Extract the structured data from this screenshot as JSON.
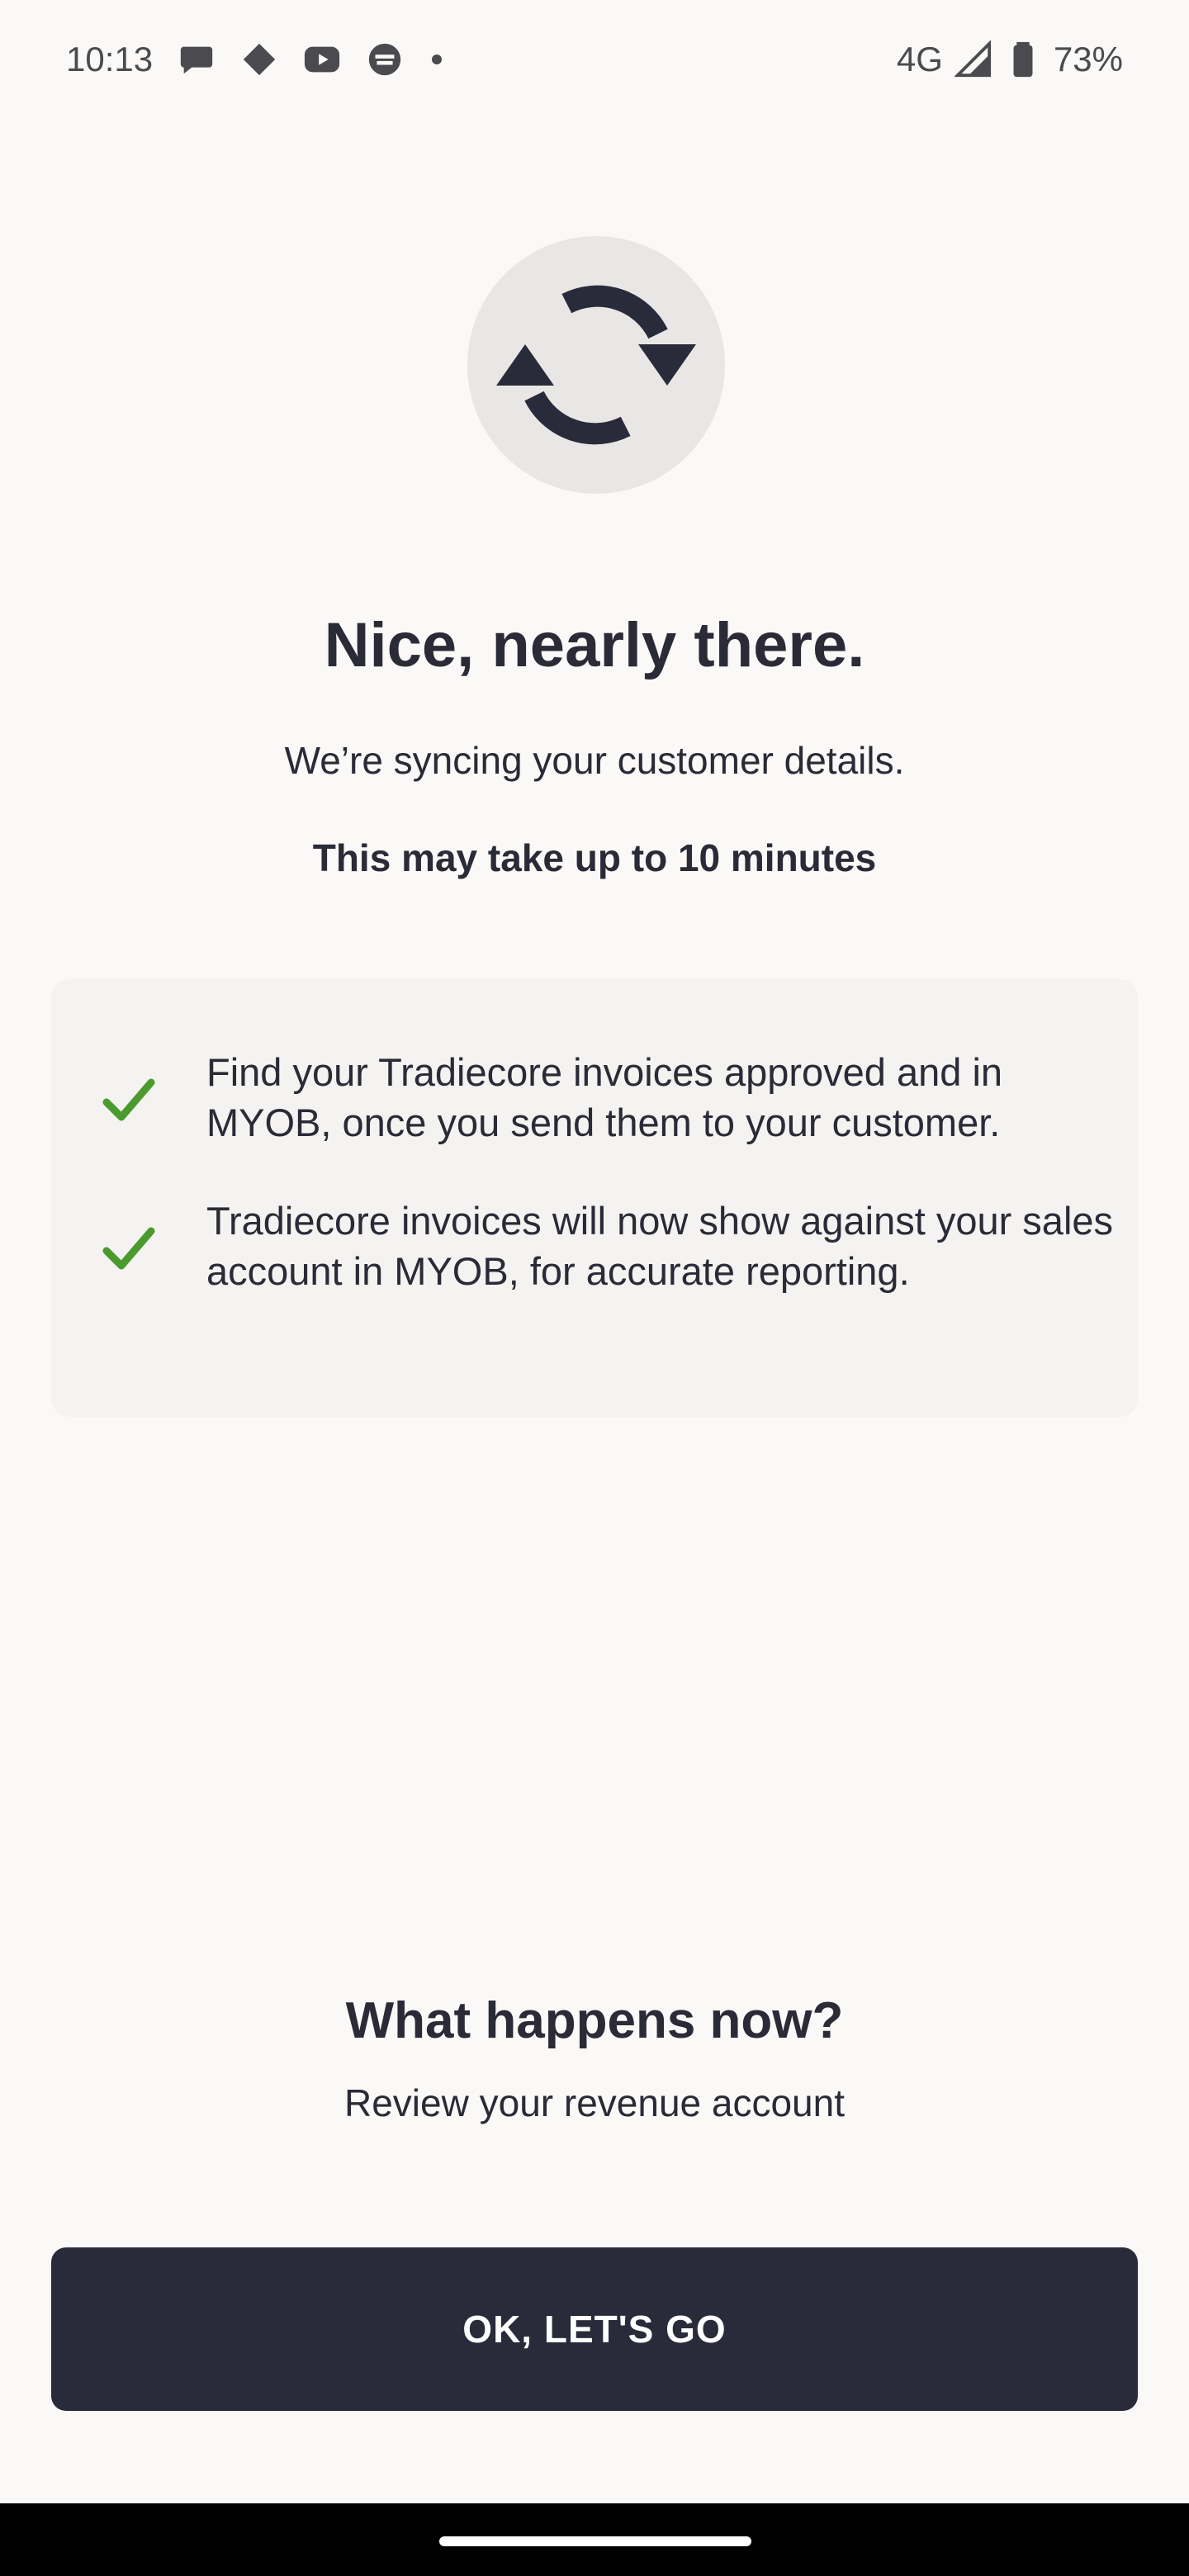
{
  "status_bar": {
    "time": "10:13",
    "network": "4G",
    "battery": "73%",
    "notification_icons": [
      "chat-icon",
      "diamond-icon",
      "youtube-icon",
      "app-icon"
    ]
  },
  "header_icon": "sync-icon",
  "title": "Nice, nearly there.",
  "subtitle": "We’re syncing your customer details.",
  "note": "This may take up to 10 minutes",
  "info_items": [
    {
      "icon": "check-icon",
      "text": "Find your Tradiecore invoices approved and in MYOB, once you send them to your customer."
    },
    {
      "icon": "check-icon",
      "text": "Tradiecore invoices will now show against your sales account in MYOB, for accurate reporting."
    }
  ],
  "next_section": {
    "title": "What happens now?",
    "subtitle": "Review your revenue account"
  },
  "cta_label": "OK, LET'S GO",
  "colors": {
    "background": "#faf9f7",
    "card": "#f4f3f1",
    "text": "#2a2b36",
    "button": "#2a2b3a",
    "check": "#4a9a2e",
    "icon_circle": "#e9e7e6"
  }
}
